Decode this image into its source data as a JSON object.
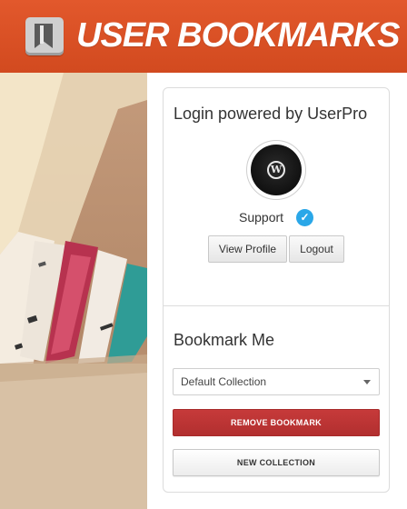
{
  "header": {
    "site_title": "USER BOOKMARKS",
    "logo_icon": "bookmark-icon",
    "background_color": "#d9512a"
  },
  "hero": {
    "image": "books-on-shelf-photo"
  },
  "login_widget": {
    "title": "Login powered by UserPro",
    "user": {
      "name": "Support",
      "verified": true,
      "avatar_icon": "wordpress-icon",
      "avatar_glyph": "W"
    },
    "buttons": {
      "view_profile": "View Profile",
      "logout": "Logout"
    }
  },
  "bookmark_widget": {
    "title": "Bookmark Me",
    "collection_select": {
      "selected": "Default Collection"
    },
    "remove_button": "REMOVE BOOKMARK",
    "new_collection_button": "NEW COLLECTION",
    "remove_button_color": "#bf3535"
  },
  "colors": {
    "verified": "#2aa7e8"
  }
}
